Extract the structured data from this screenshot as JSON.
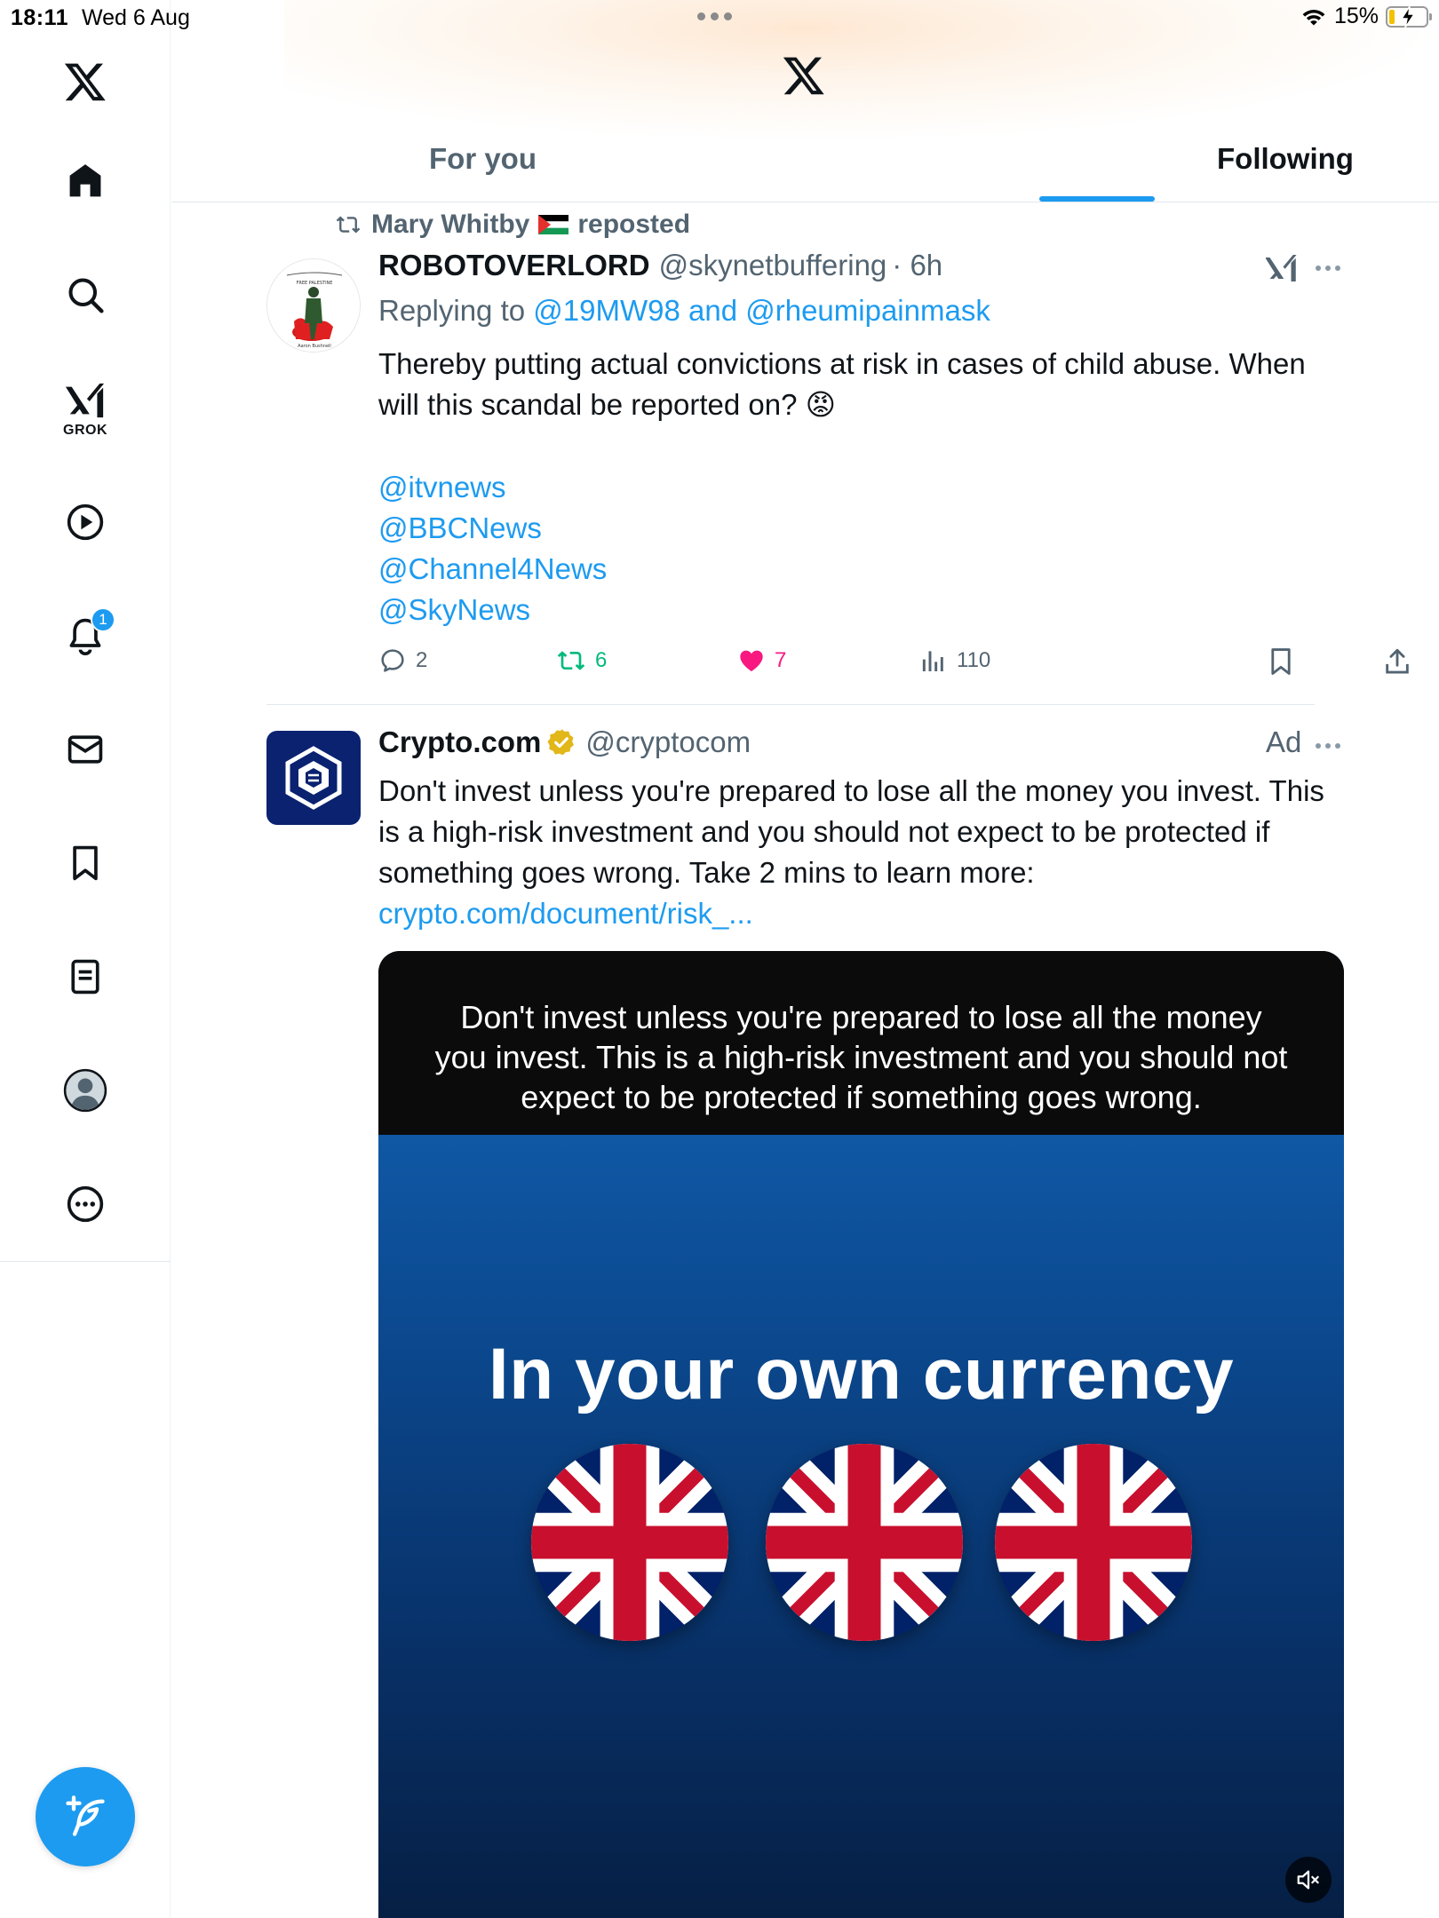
{
  "status_bar": {
    "time": "18:11",
    "date": "Wed 6 Aug",
    "battery": "15%",
    "battery_level": 0.15
  },
  "sidebar": {
    "items": [
      {
        "name": "home",
        "icon": "home-icon"
      },
      {
        "name": "search",
        "icon": "search-icon"
      },
      {
        "name": "grok",
        "icon": "grok-icon",
        "label": "GROK"
      },
      {
        "name": "video",
        "icon": "play-icon"
      },
      {
        "name": "notifications",
        "icon": "bell-icon",
        "badge": "1"
      },
      {
        "name": "messages",
        "icon": "mail-icon"
      },
      {
        "name": "bookmarks",
        "icon": "bookmark-icon"
      },
      {
        "name": "lists",
        "icon": "list-icon"
      },
      {
        "name": "profile",
        "icon": "avatar-icon"
      },
      {
        "name": "more",
        "icon": "more-icon"
      }
    ]
  },
  "header": {
    "tabs": [
      {
        "label": "For you",
        "active": false
      },
      {
        "label": "Following",
        "active": true
      }
    ]
  },
  "tweets": [
    {
      "reposted_by": "Mary Whitby",
      "repost_suffix": "reposted",
      "name": "ROBOTOVERLORD",
      "handle": "@skynetbuffering",
      "time": "· 6h",
      "replying_prefix": "Replying to",
      "replying_to": "@19MW98 and @rheumipainmask",
      "text": "Thereby putting actual convictions at risk in cases of child abuse. When will this scandal be reported on? 😡",
      "mentions": [
        "@itvnews",
        "@BBCNews",
        "@Channel4News",
        "@SkyNews"
      ],
      "stats": {
        "replies": "2",
        "reposts": "6",
        "likes": "7",
        "views": "110"
      }
    },
    {
      "name": "Crypto.com",
      "handle": "@cryptocom",
      "ad_label": "Ad",
      "text": "Don't invest unless you're prepared to lose all the money you invest. This is a high-risk investment and you should not expect to be protected if something goes wrong. Take 2 mins to learn more:",
      "link": "crypto.com/document/risk_...",
      "media": {
        "disclaimer": "Don't invest unless you're prepared to lose all the money you invest. This is a high-risk investment and you should not expect to be protected if something goes wrong.",
        "headline": "In your own currency"
      }
    }
  ],
  "colors": {
    "accent": "#1d9bf0",
    "repost_green": "#00ba7c",
    "like_pink": "#f91880",
    "text_secondary": "#536471",
    "ad_blue": "#0a2270"
  }
}
